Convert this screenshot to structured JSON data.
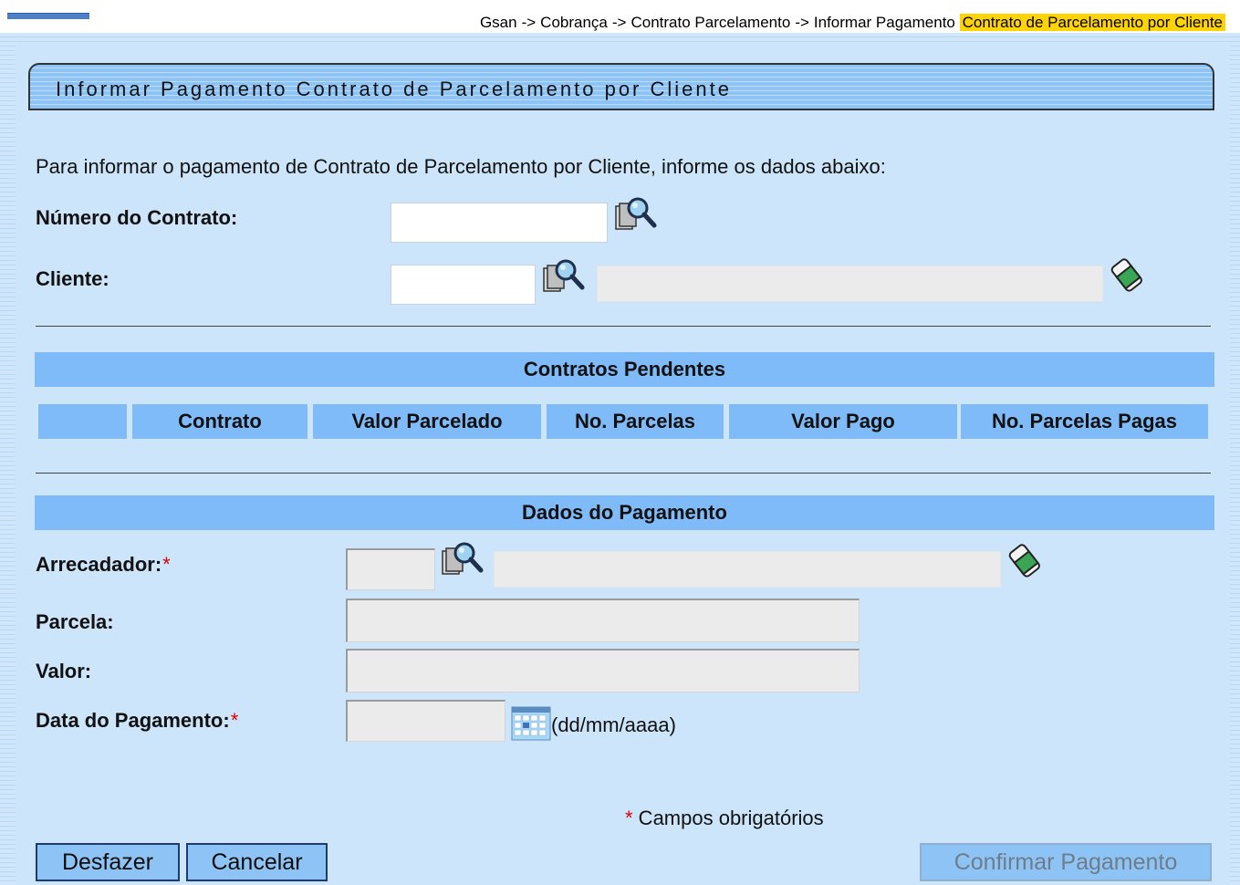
{
  "breadcrumb": {
    "items": [
      "Gsan",
      "Cobrança",
      "Contrato Parcelamento",
      "Informar Pagamento"
    ],
    "separator": "->",
    "current": "Contrato de Parcelamento por Cliente"
  },
  "page": {
    "title": "Informar Pagamento Contrato de Parcelamento por Cliente",
    "intro": "Para informar o pagamento de Contrato de Parcelamento por Cliente, informe os dados abaixo:"
  },
  "form": {
    "numero_contrato": {
      "label": "Número do Contrato:",
      "value": ""
    },
    "cliente": {
      "label": "Cliente:",
      "code_value": "",
      "name_value": ""
    }
  },
  "contratos_pendentes": {
    "title": "Contratos Pendentes",
    "columns": [
      "",
      "Contrato",
      "Valor Parcelado",
      "No. Parcelas",
      "Valor Pago",
      "No. Parcelas Pagas"
    ],
    "rows": []
  },
  "dados_pagamento": {
    "title": "Dados do Pagamento",
    "arrecadador": {
      "label": "Arrecadador:",
      "required_mark": "*",
      "code_value": "",
      "name_value": ""
    },
    "parcela": {
      "label": "Parcela:",
      "value": ""
    },
    "valor": {
      "label": "Valor:",
      "value": ""
    },
    "data_pagamento": {
      "label": "Data do Pagamento:",
      "required_mark": "*",
      "value": "",
      "format_hint": "(dd/mm/aaaa)"
    }
  },
  "required_note": {
    "mark": "*",
    "text": " Campos obrigatórios"
  },
  "buttons": {
    "desfazer": "Desfazer",
    "cancelar": "Cancelar",
    "confirmar": "Confirmar Pagamento"
  },
  "colors": {
    "section_header": "#7fbbf8",
    "panel_bg": "#cce5fb",
    "required": "#e00000",
    "breadcrumb_highlight": "#ffd400"
  }
}
